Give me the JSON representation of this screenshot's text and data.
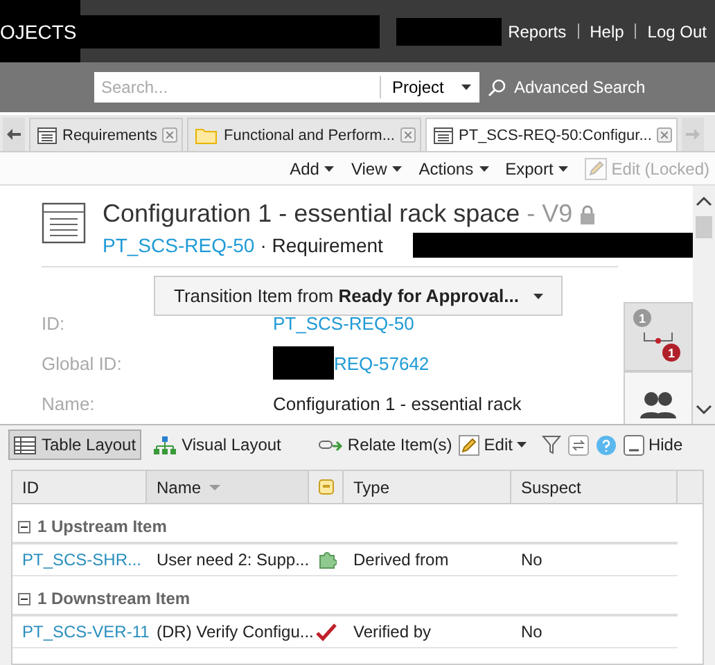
{
  "header": {
    "brand": "OJECTS",
    "links": [
      "Reports",
      "Help",
      "Log Out"
    ]
  },
  "search": {
    "placeholder": "Search...",
    "scope": "Project",
    "advanced": "Advanced Search"
  },
  "tabs": [
    {
      "label": "Requirements",
      "kind": "list",
      "selected": false
    },
    {
      "label": "Functional and Perform...",
      "kind": "folder",
      "selected": false
    },
    {
      "label": "PT_SCS-REQ-50:Configur...",
      "kind": "list",
      "selected": true
    }
  ],
  "toolbar": {
    "menus": [
      "Add",
      "View",
      "Actions",
      "Export"
    ],
    "edit": {
      "label": "Edit (Locked)",
      "disabled": true
    }
  },
  "item": {
    "title": "Configuration 1 - essential rack space",
    "version": "- V9",
    "locked": true,
    "id": "PT_SCS-REQ-50",
    "type": "· Requirement",
    "transition": "Transition Item from **Ready for Approval...**",
    "fields": [
      {
        "label": "ID:",
        "value": "PT_SCS-REQ-50",
        "kind": "link",
        "redacted": false
      },
      {
        "label": "Global ID:",
        "value": "REQ-57642",
        "kind": "link",
        "redacted": true
      },
      {
        "label": "Name:",
        "value": "Configuration 1 - essential rack",
        "kind": "text",
        "redacted": false
      }
    ],
    "relation_counts": {
      "upstream": "1",
      "downstream": "1"
    }
  },
  "relations": {
    "layouts": [
      {
        "label": "Table Layout",
        "kind": "table",
        "selected": true
      },
      {
        "label": "Visual Layout",
        "kind": "visual",
        "selected": false
      }
    ],
    "relate": "Relate Item(s)",
    "edit": "Edit",
    "hide": "Hide",
    "columns": [
      {
        "label": "ID",
        "kind": "text",
        "sorted": false
      },
      {
        "label": "Name",
        "kind": "text",
        "sorted": true
      },
      {
        "kind": "icon",
        "sorted": false
      },
      {
        "label": "Type",
        "kind": "text",
        "sorted": false
      },
      {
        "label": "Suspect",
        "kind": "text",
        "sorted": false
      }
    ],
    "groups": [
      {
        "label": "1 Upstream Item",
        "expanded": true,
        "rows": [
          {
            "id": "PT_SCS-SHR...",
            "name": "User need 2: Supp...",
            "kind": "need",
            "type": "Derived from",
            "suspect": "No"
          }
        ]
      },
      {
        "label": "1 Downstream Item",
        "expanded": true,
        "rows": [
          {
            "id": "PT_SCS-VER-11",
            "name": "(DR) Verify Configu...",
            "kind": "verification",
            "type": "Verified by",
            "suspect": "No"
          }
        ]
      }
    ]
  }
}
